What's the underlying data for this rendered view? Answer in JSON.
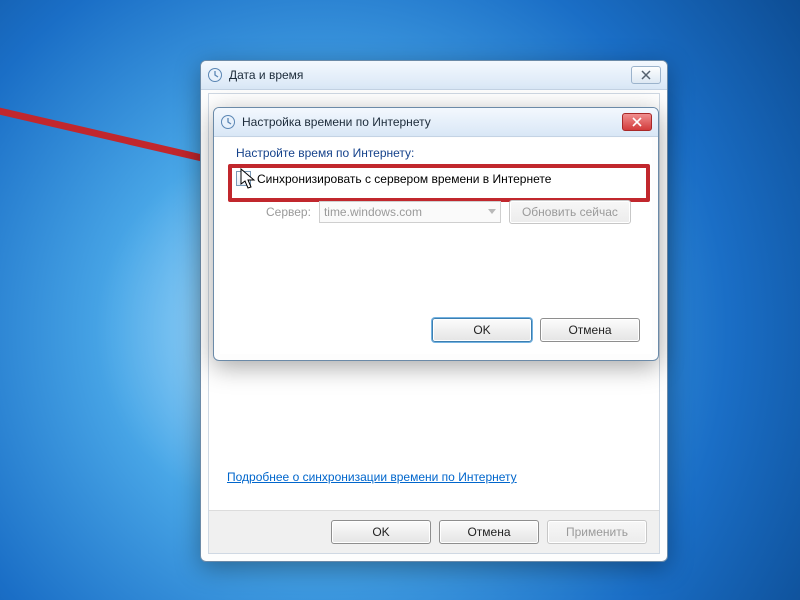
{
  "parent": {
    "title": "Дата и время",
    "link": "Подробнее о синхронизации времени по Интернету",
    "ok": "OK",
    "cancel": "Отмена",
    "apply": "Применить"
  },
  "child": {
    "title": "Настройка времени по Интернету",
    "instruction": "Настройте время по Интернету:",
    "checkbox_label": "Синхронизировать с сервером времени в Интернете",
    "server_label": "Сервер:",
    "server_value": "time.windows.com",
    "update_now": "Обновить сейчас",
    "ok": "OK",
    "cancel": "Отмена"
  },
  "colors": {
    "highlight": "#c1272d"
  }
}
